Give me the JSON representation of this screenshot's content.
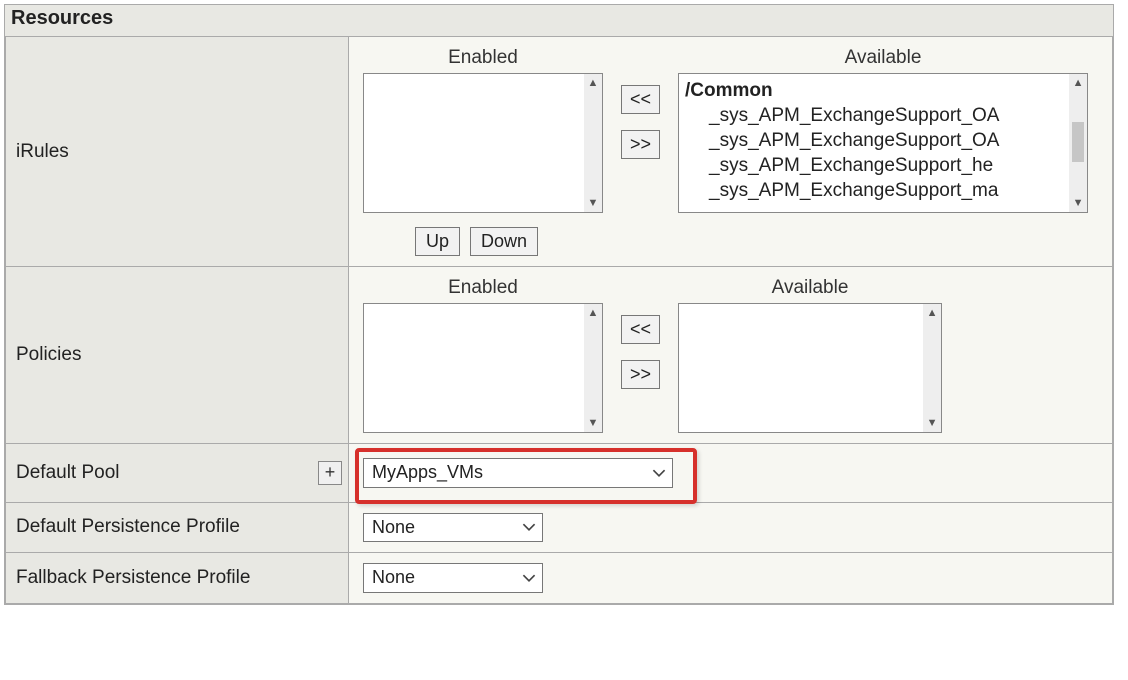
{
  "legend": "Resources",
  "common": {
    "enabledLabel": "Enabled",
    "availableLabel": "Available",
    "moveLeft": "<<",
    "moveRight": ">>",
    "upLabel": "Up",
    "downLabel": "Down",
    "plus": "+"
  },
  "rows": {
    "irules": {
      "label": "iRules",
      "enabledItems": [],
      "availableHeader": "/Common",
      "availableItems": [
        "_sys_APM_ExchangeSupport_OA",
        "_sys_APM_ExchangeSupport_OA",
        "_sys_APM_ExchangeSupport_he",
        "_sys_APM_ExchangeSupport_ma"
      ]
    },
    "policies": {
      "label": "Policies",
      "enabledItems": [],
      "availableItems": []
    },
    "defaultPool": {
      "label": "Default Pool",
      "value": "MyApps_VMs"
    },
    "defaultPersistence": {
      "label": "Default Persistence Profile",
      "value": "None"
    },
    "fallbackPersistence": {
      "label": "Fallback Persistence Profile",
      "value": "None"
    }
  }
}
